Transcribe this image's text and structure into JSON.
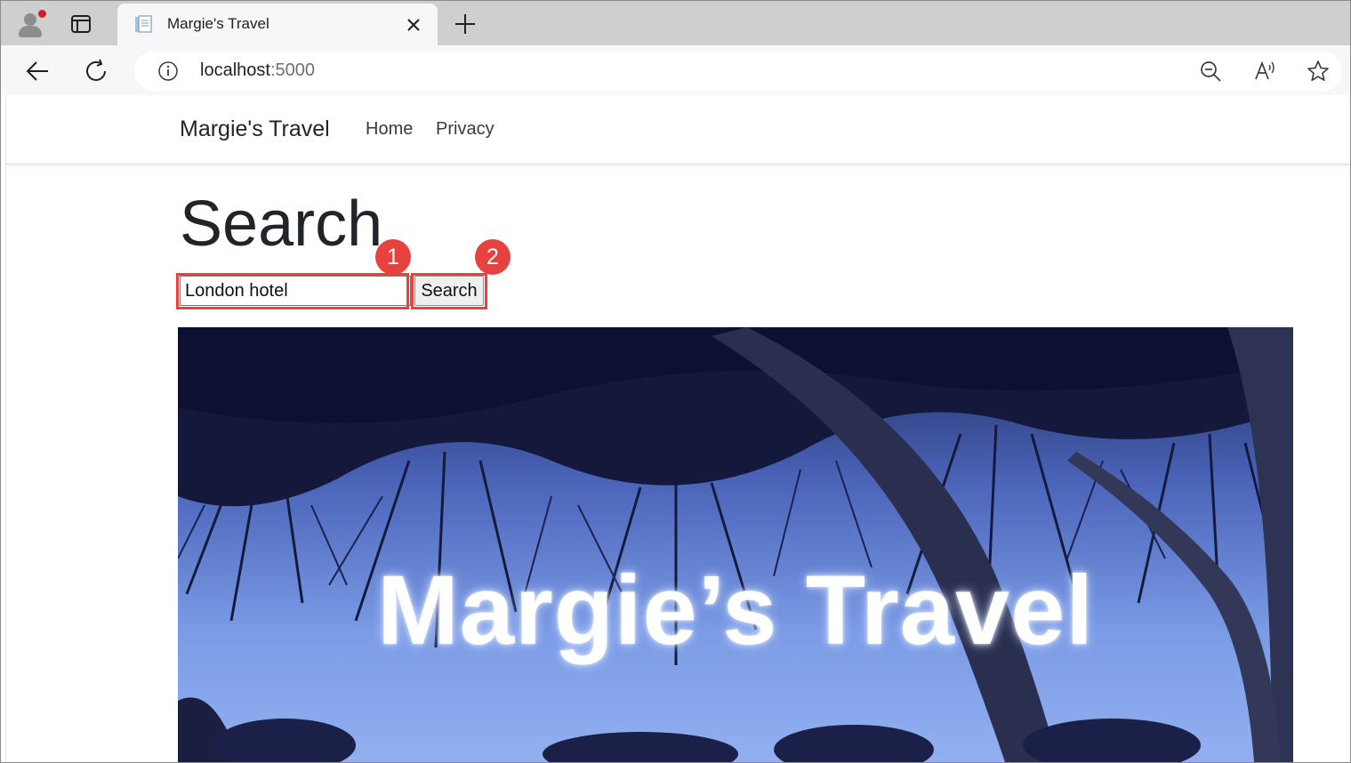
{
  "browser": {
    "tab_title": "Margie's Travel",
    "url_host": "localhost",
    "url_port": ":5000"
  },
  "site": {
    "brand": "Margie's Travel",
    "nav": [
      "Home",
      "Privacy"
    ]
  },
  "main": {
    "heading": "Search",
    "search_value": "London hotel",
    "search_button": "Search",
    "hero_text": "Margie’s Travel"
  },
  "annotations": {
    "step1": "1",
    "step2": "2"
  },
  "colors": {
    "annotation_red": "#e8423f",
    "hero_sky": "#6f8fe0"
  },
  "icons": [
    "profile-icon",
    "tab-actions-icon",
    "page-favicon-icon",
    "close-tab-icon",
    "new-tab-icon",
    "back-icon",
    "refresh-icon",
    "info-icon",
    "zoom-out-icon",
    "read-aloud-icon",
    "favorite-star-icon"
  ]
}
